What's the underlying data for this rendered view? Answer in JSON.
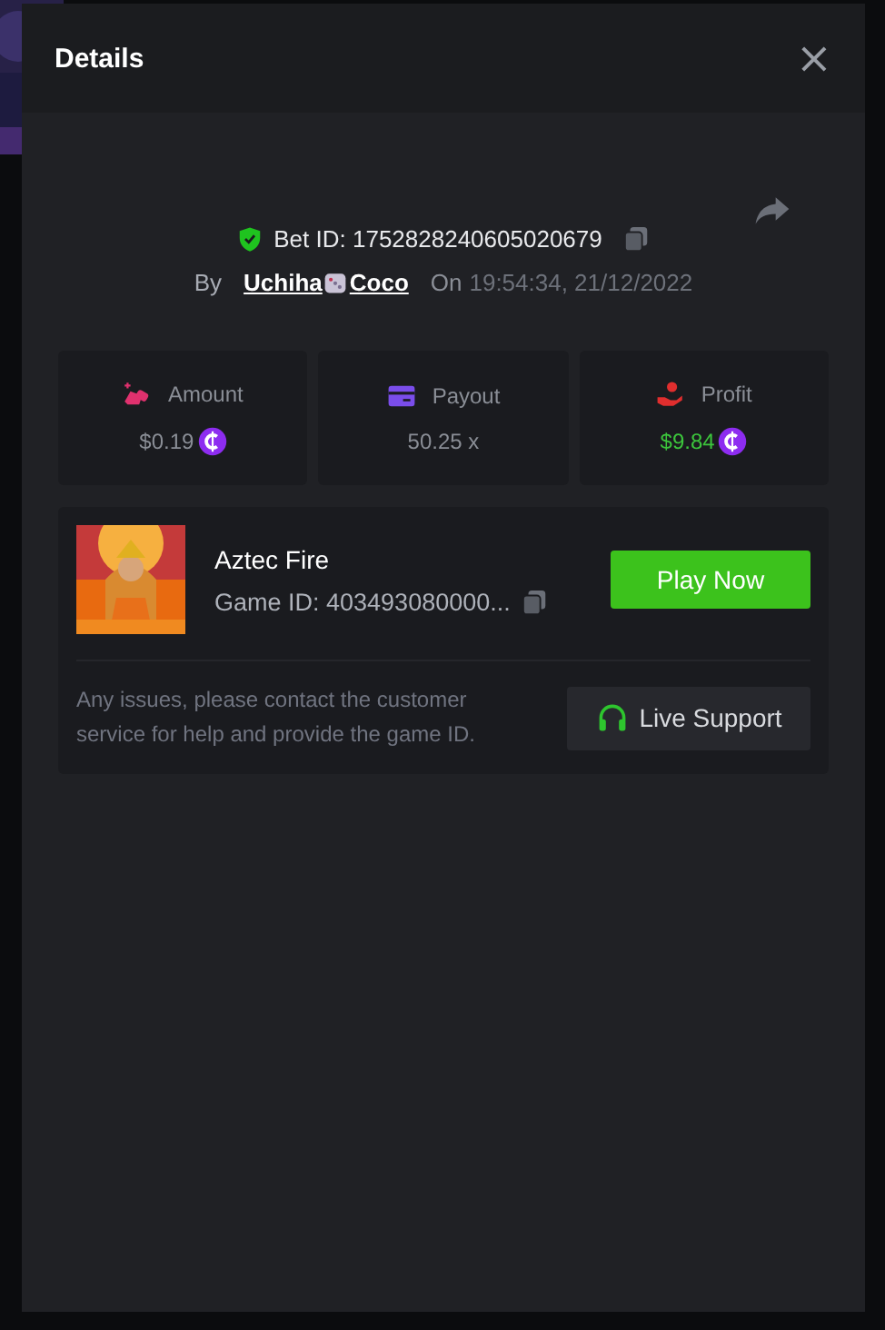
{
  "dialog": {
    "title": "Details",
    "close": "×"
  },
  "bet": {
    "label": "Bet ID:",
    "id": "1752828240605020679",
    "verified": true
  },
  "by": {
    "label": "By",
    "user_parts": [
      "Uchiha",
      "Coco"
    ],
    "on_label": "On",
    "time": "19:54:34, 21/12/2022"
  },
  "stats": [
    {
      "kind": "amount",
      "label": "Amount",
      "value": "$0.19",
      "coin": true,
      "positive": false
    },
    {
      "kind": "payout",
      "label": "Payout",
      "value": "50.25 x",
      "coin": false,
      "positive": false
    },
    {
      "kind": "profit",
      "label": "Profit",
      "value": "$9.84",
      "coin": true,
      "positive": true
    }
  ],
  "game": {
    "name": "Aztec Fire",
    "id_label": "Game ID:",
    "id": "403493080000...",
    "play": "Play Now"
  },
  "support": {
    "note": "Any issues, please contact the customer service for help and provide the game ID.",
    "button": "Live Support"
  }
}
